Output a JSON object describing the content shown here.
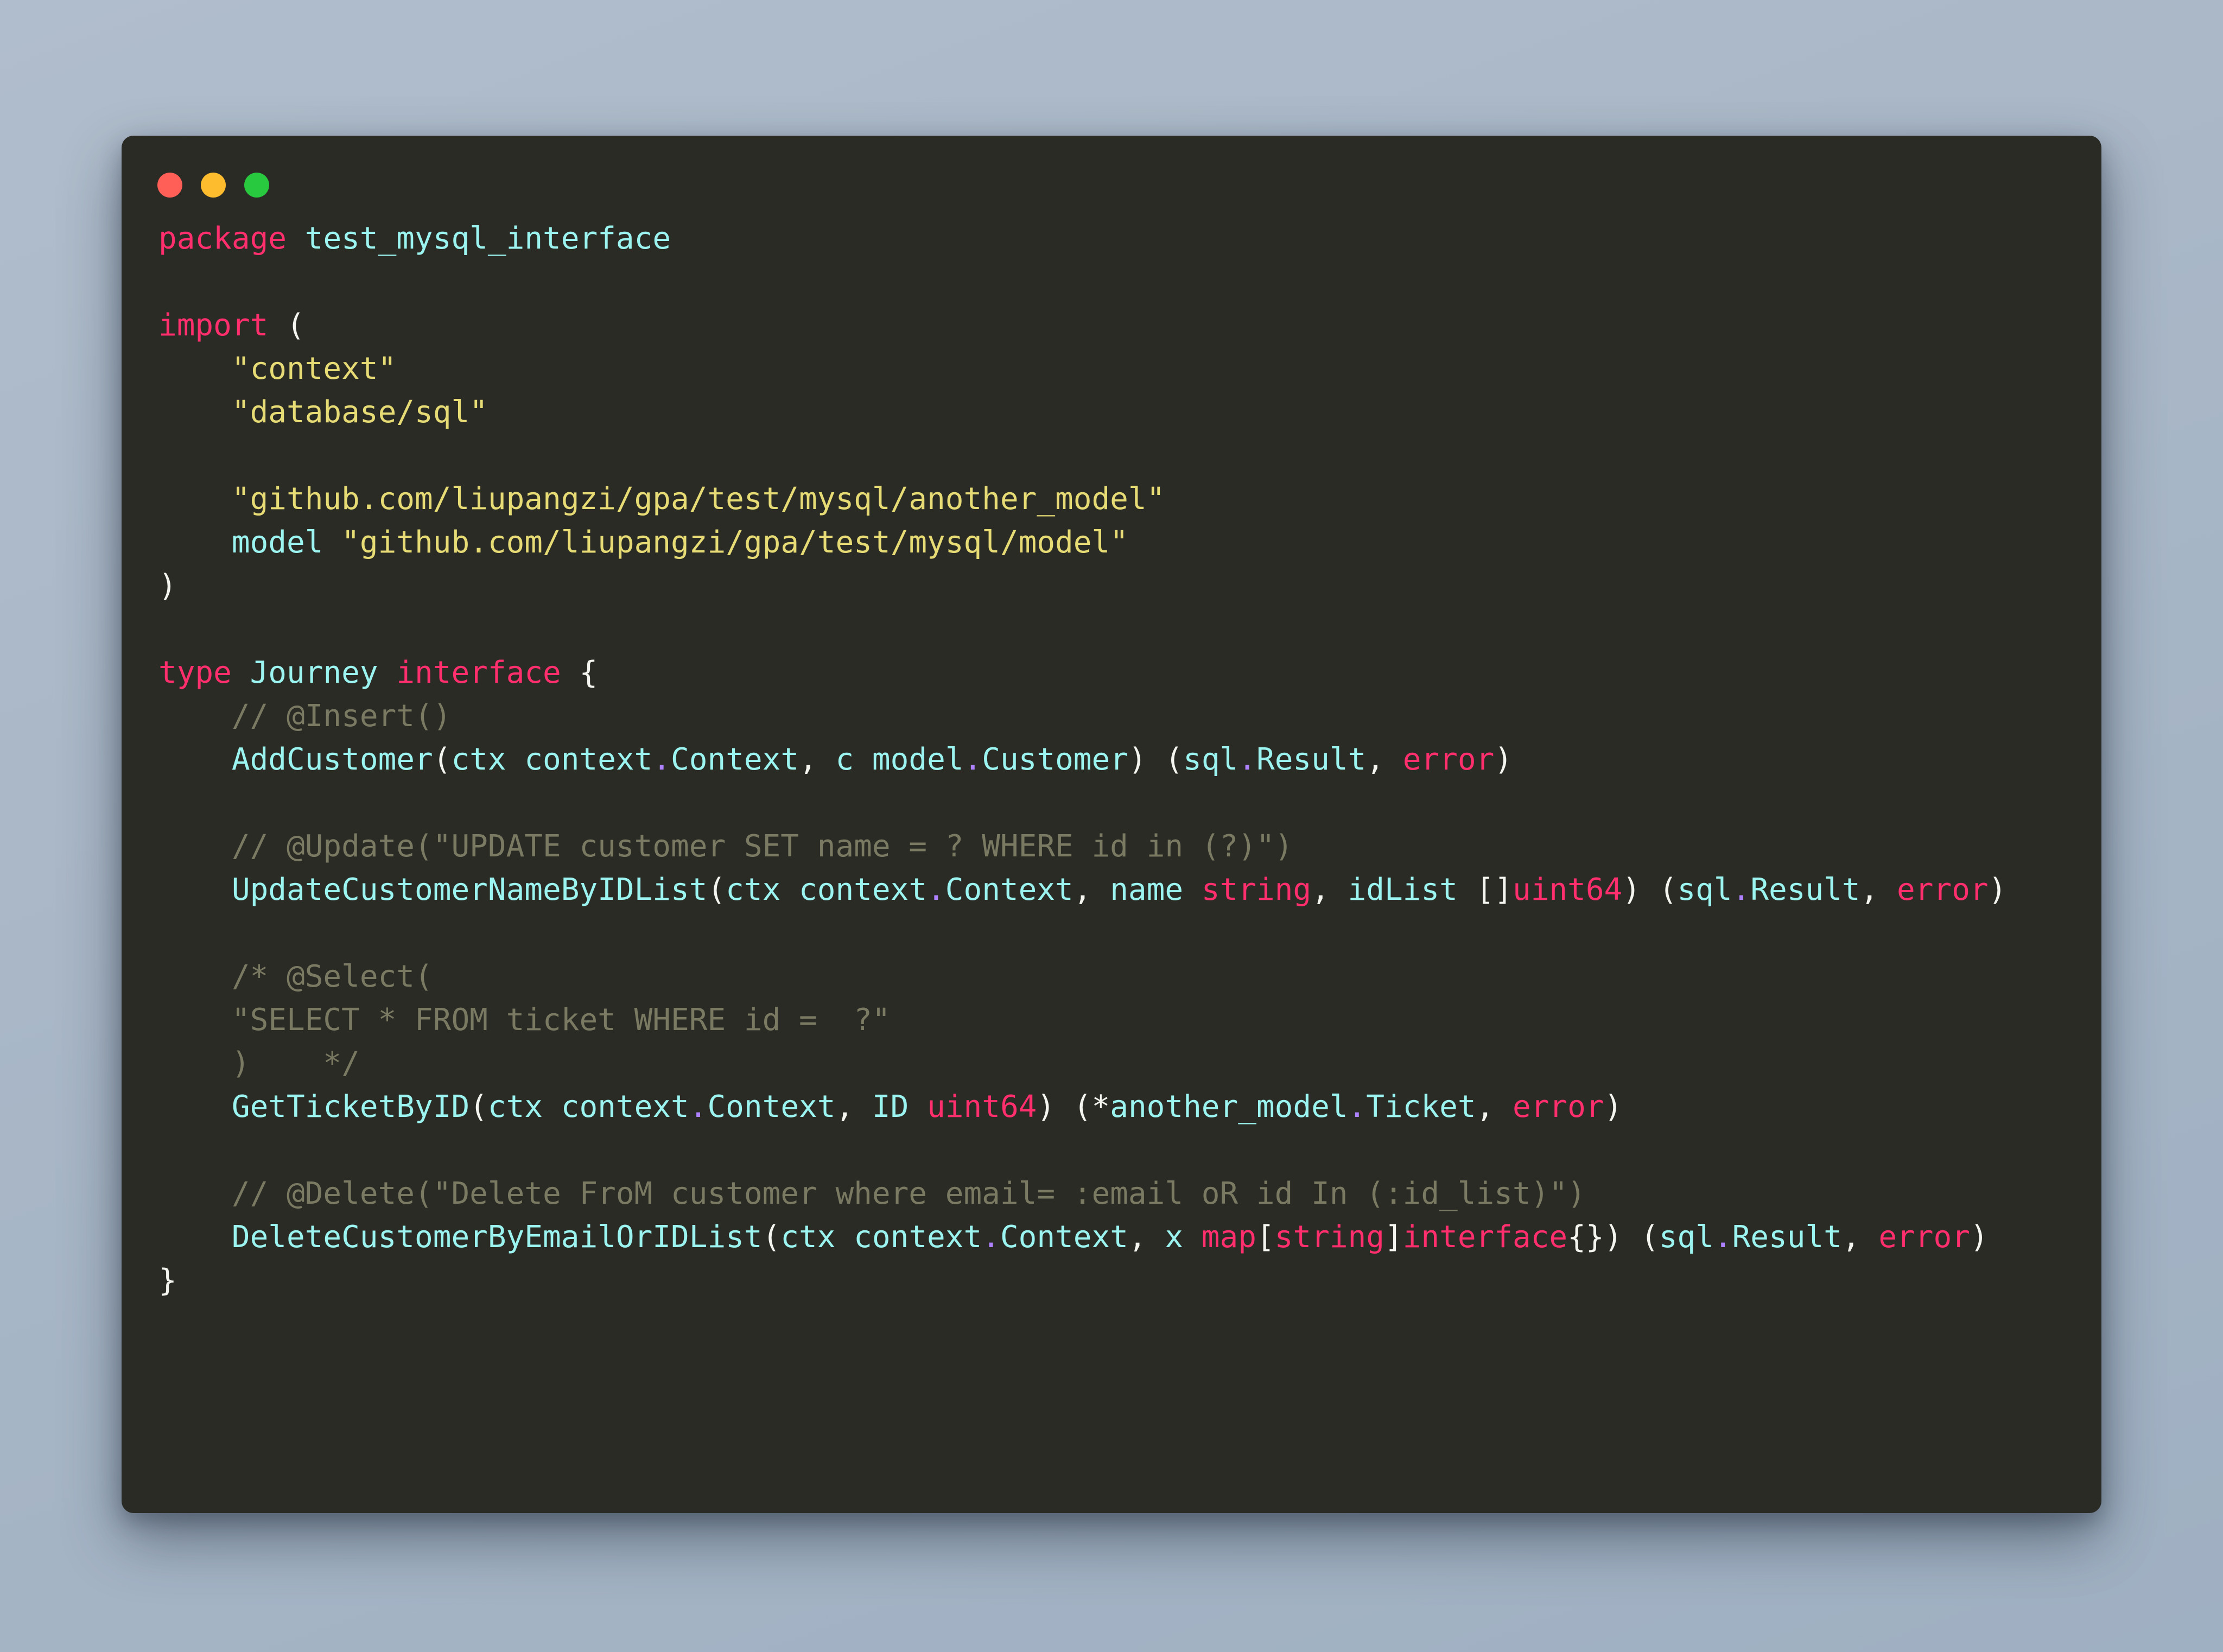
{
  "window": {
    "title": "code-snippet-window",
    "traffic_lights": [
      {
        "name": "close-button",
        "color": "#ff5f57"
      },
      {
        "name": "minimize-button",
        "color": "#fdbc2e"
      },
      {
        "name": "maximize-button",
        "color": "#28c83f"
      }
    ]
  },
  "theme": {
    "background": "#2b2b26",
    "page_background": "#a9b7c7",
    "keyword": "#ff2e6c",
    "identifier": "#9bf4f0",
    "string": "#e6db74",
    "comment": "#7a7a63",
    "punctuation": "#f5f5ef",
    "dot_operator": "#ae81ff"
  },
  "code": {
    "language": "go",
    "lines": [
      {
        "id": "line-package",
        "tokens": [
          {
            "t": "package",
            "c": "kw"
          },
          {
            "t": " ",
            "c": "pun"
          },
          {
            "t": "test_mysql_interface",
            "c": "id"
          }
        ]
      },
      {
        "id": "line-blank-1",
        "tokens": []
      },
      {
        "id": "line-import-open",
        "tokens": [
          {
            "t": "import",
            "c": "kw"
          },
          {
            "t": " (",
            "c": "pun"
          }
        ]
      },
      {
        "id": "line-import-context",
        "tokens": [
          {
            "t": "    ",
            "c": "pun"
          },
          {
            "t": "\"context\"",
            "c": "str"
          }
        ]
      },
      {
        "id": "line-import-databasesql",
        "tokens": [
          {
            "t": "    ",
            "c": "pun"
          },
          {
            "t": "\"database/sql\"",
            "c": "str"
          }
        ]
      },
      {
        "id": "line-blank-2",
        "tokens": []
      },
      {
        "id": "line-import-another-model",
        "tokens": [
          {
            "t": "    ",
            "c": "pun"
          },
          {
            "t": "\"github.com/liupangzi/gpa/test/mysql/another_model\"",
            "c": "str"
          }
        ]
      },
      {
        "id": "line-import-model-alias",
        "tokens": [
          {
            "t": "    ",
            "c": "pun"
          },
          {
            "t": "model",
            "c": "id"
          },
          {
            "t": " ",
            "c": "pun"
          },
          {
            "t": "\"github.com/liupangzi/gpa/test/mysql/model\"",
            "c": "str"
          }
        ]
      },
      {
        "id": "line-import-close",
        "tokens": [
          {
            "t": ")",
            "c": "pun"
          }
        ]
      },
      {
        "id": "line-blank-3",
        "tokens": []
      },
      {
        "id": "line-type-journey",
        "tokens": [
          {
            "t": "type",
            "c": "kw"
          },
          {
            "t": " ",
            "c": "pun"
          },
          {
            "t": "Journey",
            "c": "id"
          },
          {
            "t": " ",
            "c": "pun"
          },
          {
            "t": "interface",
            "c": "kw"
          },
          {
            "t": " {",
            "c": "pun"
          }
        ]
      },
      {
        "id": "line-comment-insert",
        "tokens": [
          {
            "t": "    ",
            "c": "pun"
          },
          {
            "t": "// @Insert()",
            "c": "cmt"
          }
        ]
      },
      {
        "id": "line-method-addcustomer",
        "tokens": [
          {
            "t": "    ",
            "c": "pun"
          },
          {
            "t": "AddCustomer",
            "c": "id"
          },
          {
            "t": "(",
            "c": "pun"
          },
          {
            "t": "ctx context",
            "c": "id"
          },
          {
            "t": ".",
            "c": "dot2"
          },
          {
            "t": "Context",
            "c": "id"
          },
          {
            "t": ", ",
            "c": "pun"
          },
          {
            "t": "c model",
            "c": "id"
          },
          {
            "t": ".",
            "c": "dot2"
          },
          {
            "t": "Customer",
            "c": "id"
          },
          {
            "t": ") (",
            "c": "pun"
          },
          {
            "t": "sql",
            "c": "id"
          },
          {
            "t": ".",
            "c": "dot2"
          },
          {
            "t": "Result",
            "c": "id"
          },
          {
            "t": ", ",
            "c": "pun"
          },
          {
            "t": "error",
            "c": "kw"
          },
          {
            "t": ")",
            "c": "pun"
          }
        ]
      },
      {
        "id": "line-blank-4",
        "tokens": []
      },
      {
        "id": "line-comment-update",
        "tokens": [
          {
            "t": "    ",
            "c": "pun"
          },
          {
            "t": "// @Update(\"UPDATE customer SET name = ? WHERE id in (?)\")",
            "c": "cmt"
          }
        ]
      },
      {
        "id": "line-method-updatecustomernamebyidlist",
        "tokens": [
          {
            "t": "    ",
            "c": "pun"
          },
          {
            "t": "UpdateCustomerNameByIDList",
            "c": "id"
          },
          {
            "t": "(",
            "c": "pun"
          },
          {
            "t": "ctx context",
            "c": "id"
          },
          {
            "t": ".",
            "c": "dot2"
          },
          {
            "t": "Context",
            "c": "id"
          },
          {
            "t": ", ",
            "c": "pun"
          },
          {
            "t": "name ",
            "c": "id"
          },
          {
            "t": "string",
            "c": "kw"
          },
          {
            "t": ", ",
            "c": "pun"
          },
          {
            "t": "idList ",
            "c": "id"
          },
          {
            "t": "[]",
            "c": "pun"
          },
          {
            "t": "uint64",
            "c": "kw"
          },
          {
            "t": ") (",
            "c": "pun"
          },
          {
            "t": "sql",
            "c": "id"
          },
          {
            "t": ".",
            "c": "dot2"
          },
          {
            "t": "Result",
            "c": "id"
          },
          {
            "t": ", ",
            "c": "pun"
          },
          {
            "t": "error",
            "c": "kw"
          },
          {
            "t": ")",
            "c": "pun"
          }
        ]
      },
      {
        "id": "line-blank-5",
        "tokens": []
      },
      {
        "id": "line-comment-select-open",
        "tokens": [
          {
            "t": "    ",
            "c": "pun"
          },
          {
            "t": "/* @Select(",
            "c": "cmt"
          }
        ]
      },
      {
        "id": "line-comment-select-sql",
        "tokens": [
          {
            "t": "    ",
            "c": "pun"
          },
          {
            "t": "\"SELECT * FROM ticket WHERE id =  ?\"",
            "c": "cmt"
          }
        ]
      },
      {
        "id": "line-comment-select-close",
        "tokens": [
          {
            "t": "    ",
            "c": "pun"
          },
          {
            "t": ")    */",
            "c": "cmt"
          }
        ]
      },
      {
        "id": "line-method-getticketbyid",
        "tokens": [
          {
            "t": "    ",
            "c": "pun"
          },
          {
            "t": "GetTicketByID",
            "c": "id"
          },
          {
            "t": "(",
            "c": "pun"
          },
          {
            "t": "ctx context",
            "c": "id"
          },
          {
            "t": ".",
            "c": "dot2"
          },
          {
            "t": "Context",
            "c": "id"
          },
          {
            "t": ", ",
            "c": "pun"
          },
          {
            "t": "ID ",
            "c": "id"
          },
          {
            "t": "uint64",
            "c": "kw"
          },
          {
            "t": ") (*",
            "c": "pun"
          },
          {
            "t": "another_model",
            "c": "id"
          },
          {
            "t": ".",
            "c": "dot2"
          },
          {
            "t": "Ticket",
            "c": "id"
          },
          {
            "t": ", ",
            "c": "pun"
          },
          {
            "t": "error",
            "c": "kw"
          },
          {
            "t": ")",
            "c": "pun"
          }
        ]
      },
      {
        "id": "line-blank-6",
        "tokens": []
      },
      {
        "id": "line-comment-delete",
        "tokens": [
          {
            "t": "    ",
            "c": "pun"
          },
          {
            "t": "// @Delete(\"Delete FroM customer where email= :email oR id In (:id_list)\")",
            "c": "cmt"
          }
        ]
      },
      {
        "id": "line-method-deletecustomerbyemailoridlist",
        "tokens": [
          {
            "t": "    ",
            "c": "pun"
          },
          {
            "t": "DeleteCustomerByEmailOrIDList",
            "c": "id"
          },
          {
            "t": "(",
            "c": "pun"
          },
          {
            "t": "ctx context",
            "c": "id"
          },
          {
            "t": ".",
            "c": "dot2"
          },
          {
            "t": "Context",
            "c": "id"
          },
          {
            "t": ", ",
            "c": "pun"
          },
          {
            "t": "x ",
            "c": "id"
          },
          {
            "t": "map",
            "c": "kw"
          },
          {
            "t": "[",
            "c": "pun"
          },
          {
            "t": "string",
            "c": "kw"
          },
          {
            "t": "]",
            "c": "pun"
          },
          {
            "t": "interface",
            "c": "kw"
          },
          {
            "t": "{}",
            "c": "pun"
          },
          {
            "t": ") (",
            "c": "pun"
          },
          {
            "t": "sql",
            "c": "id"
          },
          {
            "t": ".",
            "c": "dot2"
          },
          {
            "t": "Result",
            "c": "id"
          },
          {
            "t": ", ",
            "c": "pun"
          },
          {
            "t": "error",
            "c": "kw"
          },
          {
            "t": ")",
            "c": "pun"
          }
        ]
      },
      {
        "id": "line-interface-close",
        "tokens": [
          {
            "t": "}",
            "c": "pun"
          }
        ]
      }
    ]
  }
}
